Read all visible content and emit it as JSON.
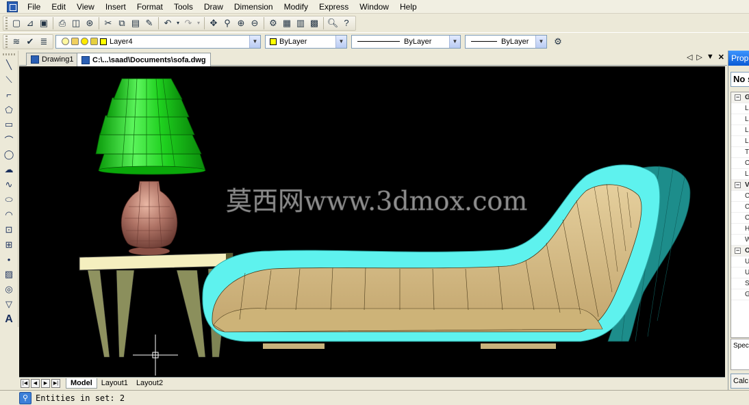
{
  "menubar": {
    "items": [
      "File",
      "Edit",
      "View",
      "Insert",
      "Format",
      "Tools",
      "Draw",
      "Dimension",
      "Modify",
      "Express",
      "Window",
      "Help"
    ]
  },
  "layer_toolbar": {
    "current_layer": "Layer4",
    "color": "ByLayer",
    "linetype": "ByLayer",
    "lineweight": "ByLayer",
    "layer_swatch_color": "#ffff00"
  },
  "doc_tabs": [
    {
      "label": "Drawing1",
      "active": false
    },
    {
      "label": "C:\\...\\saad\\Documents\\sofa.dwg",
      "active": true
    }
  ],
  "canvas": {
    "background": "#000000",
    "watermark": "莫西网www.3dmox.com"
  },
  "layout_tabs": [
    {
      "label": "Model",
      "active": true
    },
    {
      "label": "Layout1",
      "active": false
    },
    {
      "label": "Layout2",
      "active": false
    }
  ],
  "properties_panel": {
    "title": "Prop",
    "selection": "No s",
    "rows": [
      {
        "type": "cat",
        "text": "G"
      },
      {
        "type": "item",
        "text": "La"
      },
      {
        "type": "item",
        "text": "Li"
      },
      {
        "type": "item",
        "text": "Li"
      },
      {
        "type": "item",
        "text": "Li"
      },
      {
        "type": "item",
        "text": "Th"
      },
      {
        "type": "item",
        "text": "C"
      },
      {
        "type": "item",
        "text": "Li"
      },
      {
        "type": "cat",
        "text": "V"
      },
      {
        "type": "item",
        "text": "C"
      },
      {
        "type": "item",
        "text": "C"
      },
      {
        "type": "item",
        "text": "C"
      },
      {
        "type": "item",
        "text": "H"
      },
      {
        "type": "item",
        "text": "W"
      },
      {
        "type": "cat",
        "text": "O"
      },
      {
        "type": "item",
        "text": "U"
      },
      {
        "type": "item",
        "text": "U"
      },
      {
        "type": "item",
        "text": "S"
      },
      {
        "type": "item",
        "text": "G"
      }
    ],
    "special": "Speci",
    "calc": "Calc"
  },
  "statusbar": {
    "text": "Entities in set: 2"
  }
}
